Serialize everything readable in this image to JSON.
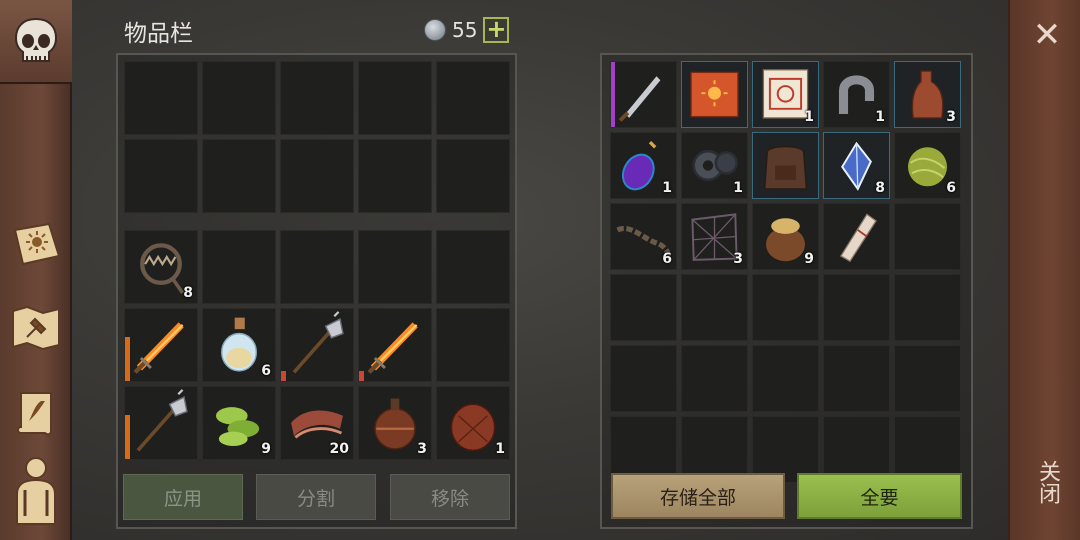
{
  "header": {
    "title": "物品栏",
    "coins": "55",
    "plus": "+"
  },
  "close": {
    "x": "✕",
    "label": "关闭"
  },
  "inventory": {
    "top_slots": 10,
    "bottom_rows": [
      [
        {
          "icon": "bear-trap-icon",
          "count": "8"
        },
        {},
        {},
        {},
        {}
      ],
      [
        {
          "icon": "flaming-sword-icon",
          "count": "",
          "dur": "orange"
        },
        {
          "icon": "potion-flask-icon",
          "count": "6"
        },
        {
          "icon": "halberd-icon",
          "count": "",
          "dur": "red"
        },
        {
          "icon": "flaming-sword-icon",
          "count": "",
          "dur": "red"
        },
        {}
      ],
      [
        {
          "icon": "halberd-icon",
          "count": "",
          "dur": "orange"
        },
        {
          "icon": "green-herb-icon",
          "count": "9"
        },
        {
          "icon": "meat-strips-icon",
          "count": "20"
        },
        {
          "icon": "leather-flask-icon",
          "count": "3"
        },
        {
          "icon": "water-pouch-icon",
          "count": "1"
        }
      ]
    ],
    "buttons": {
      "apply": "应用",
      "split": "分割",
      "remove": "移除"
    }
  },
  "storage": {
    "rows": [
      [
        {
          "icon": "dagger-icon",
          "count": "",
          "rare": true
        },
        {
          "icon": "sun-book-icon",
          "count": "",
          "hl": true
        },
        {
          "icon": "map-scroll-icon",
          "count": "1",
          "hl": true
        },
        {
          "icon": "horseshoe-magnet-icon",
          "count": "1"
        },
        {
          "icon": "bottle-icon",
          "count": "3",
          "hl": true
        }
      ],
      [
        {
          "icon": "purple-elixir-icon",
          "count": "1"
        },
        {
          "icon": "gears-icon",
          "count": "1"
        },
        {
          "icon": "backpack-icon",
          "count": "",
          "hl": true
        },
        {
          "icon": "crystal-icon",
          "count": "8",
          "hl": true
        },
        {
          "icon": "fiber-ball-icon",
          "count": "6"
        }
      ],
      [
        {
          "icon": "chain-icon",
          "count": "6"
        },
        {
          "icon": "net-icon",
          "count": "3"
        },
        {
          "icon": "grain-sack-icon",
          "count": "9"
        },
        {
          "icon": "paper-roll-icon",
          "count": ""
        },
        {}
      ],
      [
        {},
        {},
        {},
        {},
        {}
      ],
      [
        {},
        {},
        {},
        {},
        {}
      ],
      [
        {},
        {},
        {},
        {},
        {}
      ]
    ],
    "buttons": {
      "store_all": "存储全部",
      "take_all": "全要"
    }
  },
  "sidebar": [
    "skull-icon",
    "sun-book-icon",
    "crafting-map-icon",
    "quest-scroll-icon",
    "character-icon"
  ]
}
